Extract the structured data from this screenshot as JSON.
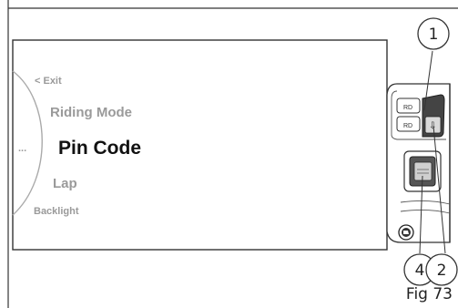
{
  "menu": {
    "items": [
      {
        "label": "< Exit"
      },
      {
        "label": "Riding Mode"
      },
      {
        "label": "Pin Code"
      },
      {
        "label": "Lap"
      },
      {
        "label": "Backlight"
      }
    ],
    "ellipsis": "...",
    "selected_label": "Pin Code"
  },
  "switch_labels": {
    "top_button": "RD",
    "bottom_button": "RD",
    "arrow_button": "⇩"
  },
  "callouts": [
    "1",
    "2",
    "4"
  ],
  "caption": "Fig 73",
  "colors": {
    "selected_text": "#111111",
    "inactive_text": "#9a9a9a",
    "line": "#333333"
  }
}
